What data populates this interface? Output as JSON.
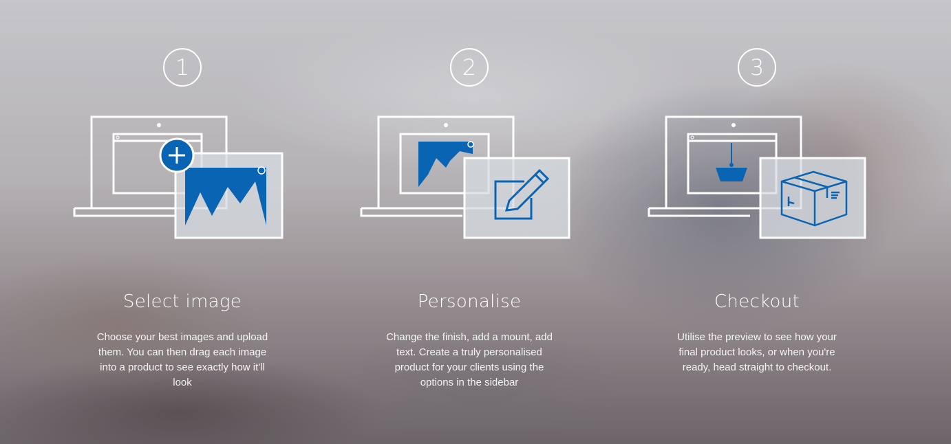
{
  "steps": [
    {
      "number": "1",
      "title": "Select image",
      "description": "Choose your best images and upload them. You can then drag each image into a product to see exactly how it'll look",
      "icon": "laptop-add-image-icon"
    },
    {
      "number": "2",
      "title": "Personalise",
      "description": "Change the finish, add a mount, add text. Create a truly personalised product for your clients using the options in the sidebar",
      "icon": "laptop-edit-icon"
    },
    {
      "number": "3",
      "title": "Checkout",
      "description": "Utilise the preview to see how your final product looks, or when you're ready, head straight to checkout.",
      "icon": "laptop-basket-box-icon"
    }
  ],
  "colors": {
    "accent": "#0a64b4",
    "line": "#ffffff"
  }
}
